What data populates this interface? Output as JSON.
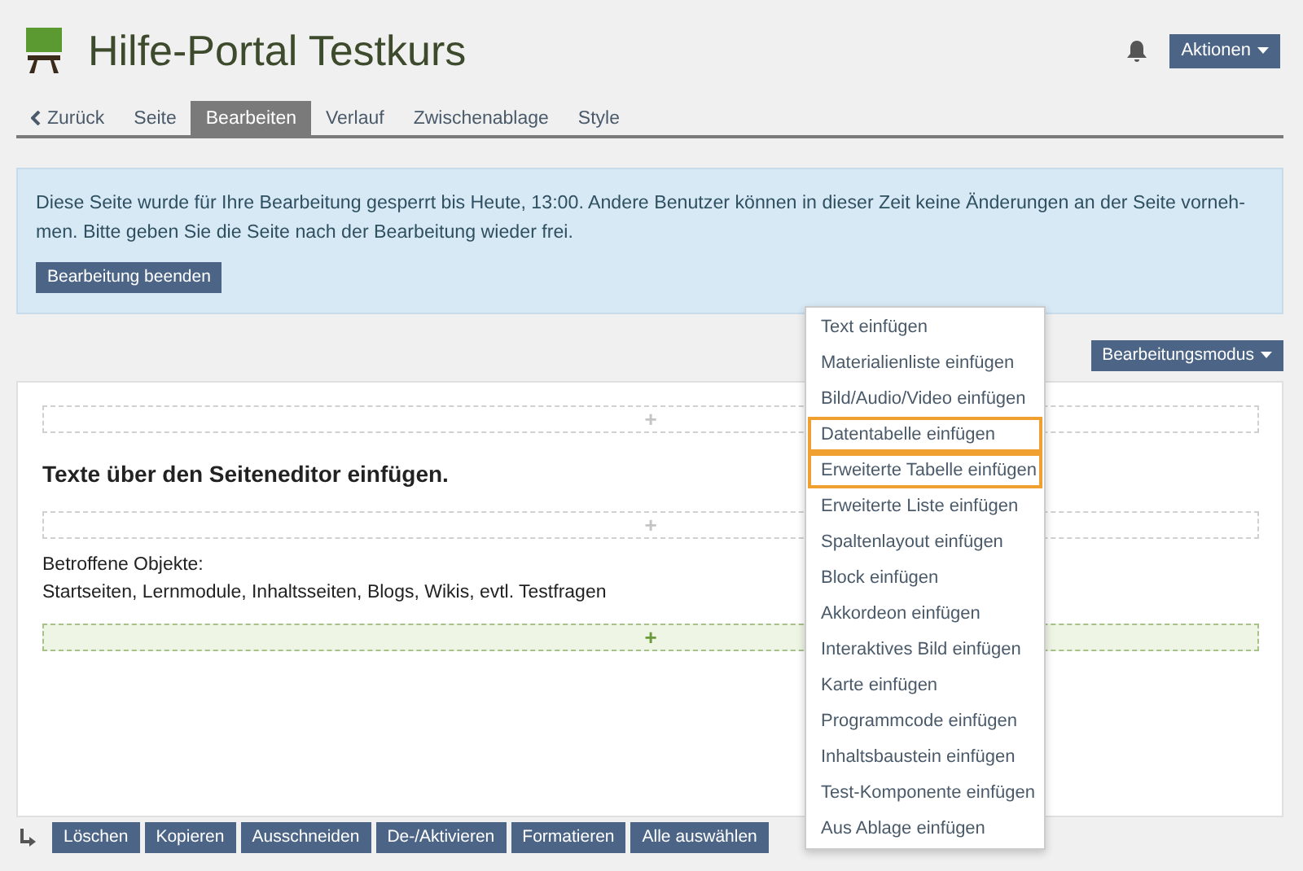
{
  "header": {
    "title": "Hilfe-Portal Testkurs",
    "actions_button": "Aktionen"
  },
  "tabs": [
    {
      "label": "Zurück",
      "kind": "back",
      "selected": false
    },
    {
      "label": "Seite",
      "kind": "tab",
      "selected": false
    },
    {
      "label": "Bearbeiten",
      "kind": "tab",
      "selected": true
    },
    {
      "label": "Verlauf",
      "kind": "tab",
      "selected": false
    },
    {
      "label": "Zwischenablage",
      "kind": "tab",
      "selected": false
    },
    {
      "label": "Style",
      "kind": "tab",
      "selected": false
    }
  ],
  "notice": {
    "text": "Diese Seite wurde für Ihre Bearbeitung gesperrt bis Heute, 13:00. Andere Benutzer können in dieser Zeit keine Änderungen an der Seite vorneh-men. Bitte geben Sie die Seite nach der Bearbeitung wieder frei.",
    "button": "Bearbeitung beenden"
  },
  "mode_button": "Bearbeitungsmodus",
  "editor": [
    {
      "kind": "dropzone",
      "label": "+",
      "active": false
    },
    {
      "kind": "heading",
      "text": "Texte über den Seiteneditor einfügen."
    },
    {
      "kind": "dropzone",
      "label": "+",
      "active": false
    },
    {
      "kind": "paragraph",
      "lines": [
        "Betroffene Objekte:",
        "Startseiten, Lernmodule, Inhaltsseiten, Blogs, Wikis, evtl. Testfragen"
      ]
    },
    {
      "kind": "dropzone",
      "label": "+",
      "active": true
    }
  ],
  "insert_menu": [
    {
      "label": "Text einfügen",
      "highlighted": false
    },
    {
      "label": "Materialienliste einfügen",
      "highlighted": false
    },
    {
      "label": "Bild/Audio/Video einfügen",
      "highlighted": false
    },
    {
      "label": "Datentabelle einfügen",
      "highlighted": true
    },
    {
      "label": "Erweiterte Tabelle einfügen",
      "highlighted": true
    },
    {
      "label": "Erweiterte Liste einfügen",
      "highlighted": false
    },
    {
      "label": "Spaltenlayout einfügen",
      "highlighted": false
    },
    {
      "label": "Block einfügen",
      "highlighted": false
    },
    {
      "label": "Akkordeon einfügen",
      "highlighted": false
    },
    {
      "label": "Interaktives Bild einfügen",
      "highlighted": false
    },
    {
      "label": "Karte einfügen",
      "highlighted": false
    },
    {
      "label": "Programmcode einfügen",
      "highlighted": false
    },
    {
      "label": "Inhaltsbaustein einfügen",
      "highlighted": false
    },
    {
      "label": "Test-Komponente einfügen",
      "highlighted": false
    },
    {
      "label": "Aus Ablage einfügen",
      "highlighted": false
    }
  ],
  "bottom_actions": [
    "Löschen",
    "Kopieren",
    "Ausschneiden",
    "De-/Aktivieren",
    "Formatieren",
    "Alle auswählen"
  ]
}
